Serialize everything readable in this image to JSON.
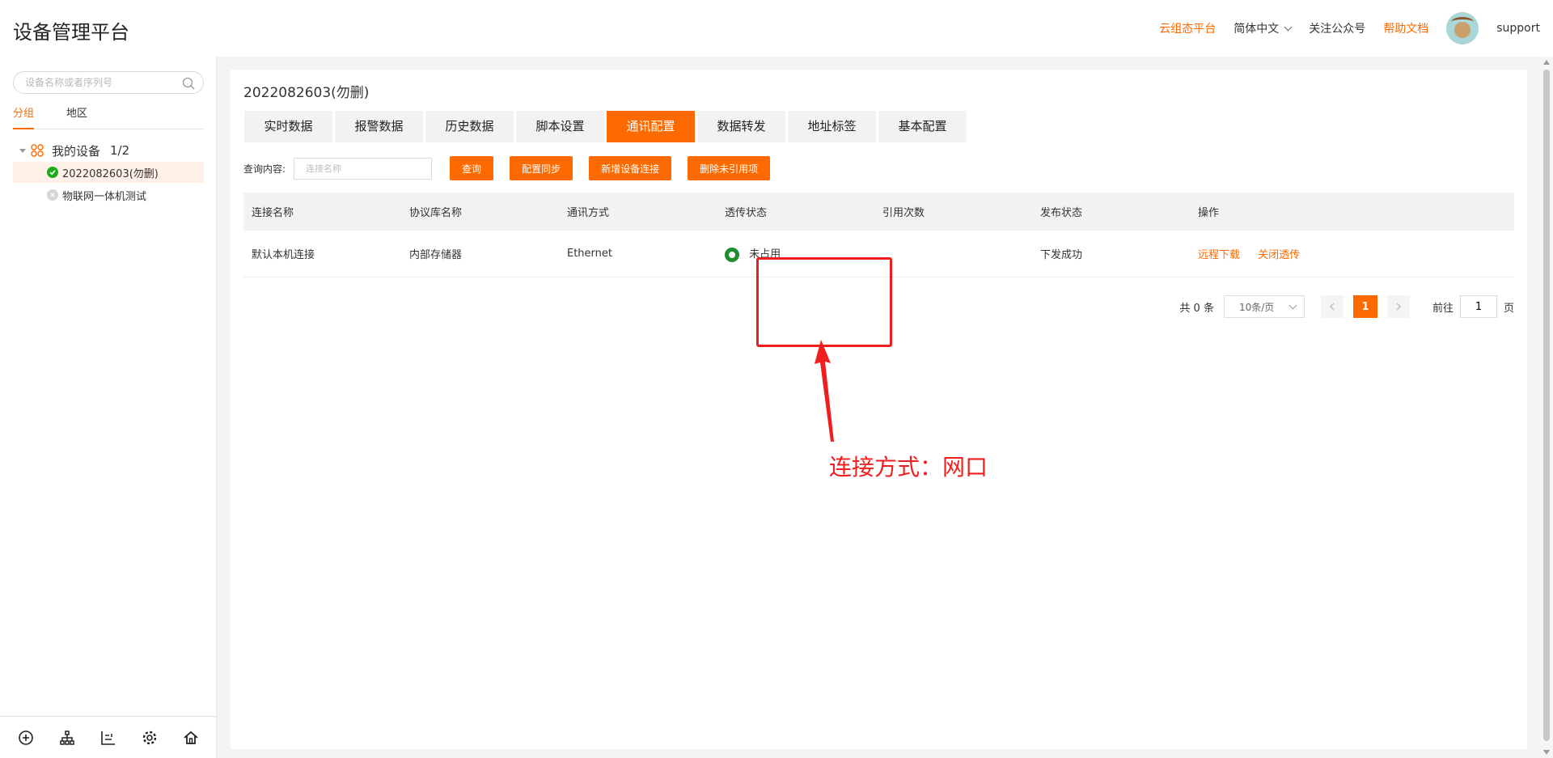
{
  "app": {
    "title": "设备管理平台"
  },
  "header": {
    "links": {
      "cloud": "云组态平台",
      "language": "简体中文",
      "follow": "关注公众号",
      "help": "帮助文档"
    },
    "user": "support"
  },
  "sidebar": {
    "search_placeholder": "设备名称或者序列号",
    "tabs": [
      "分组",
      "地区"
    ],
    "tree": {
      "root_label": "我的设备",
      "root_count": "1/2",
      "items": [
        {
          "label": "2022082603(勿删)",
          "status": "online"
        },
        {
          "label": "物联网一体机测试",
          "status": "offline"
        }
      ]
    },
    "bottom_icons": [
      "add-icon",
      "org-tree-icon",
      "chart-icon",
      "settings-icon",
      "home-icon"
    ]
  },
  "main": {
    "device_title": "2022082603(勿删)",
    "tabs": [
      "实时数据",
      "报警数据",
      "历史数据",
      "脚本设置",
      "通讯配置",
      "数据转发",
      "地址标签",
      "基本配置"
    ],
    "active_tab": "通讯配置",
    "query": {
      "label": "查询内容:",
      "placeholder": "连接名称",
      "buttons": {
        "search": "查询",
        "sync": "配置同步",
        "add": "新增设备连接",
        "delete_unused": "删除未引用项"
      }
    },
    "table": {
      "columns": [
        "连接名称",
        "协议库名称",
        "通讯方式",
        "透传状态",
        "引用次数",
        "发布状态",
        "操作"
      ],
      "rows": [
        {
          "name": "默认本机连接",
          "protocol": "内部存储器",
          "comm": "Ethernet",
          "passthrough": "未占用",
          "refs": "",
          "publish": "下发成功",
          "actions": [
            "远程下载",
            "关闭透传"
          ]
        }
      ]
    },
    "pagination": {
      "total": "共 0 条",
      "page_size": "10条/页",
      "current": "1",
      "goto_label": "前往",
      "goto_value": "1",
      "page_suffix": "页"
    }
  },
  "annotation": {
    "text": "连接方式：网口",
    "color": "#f01e1e"
  },
  "colors": {
    "accent": "#ff6a00",
    "online": "#1aad19",
    "ring": "#1e8e2e"
  }
}
